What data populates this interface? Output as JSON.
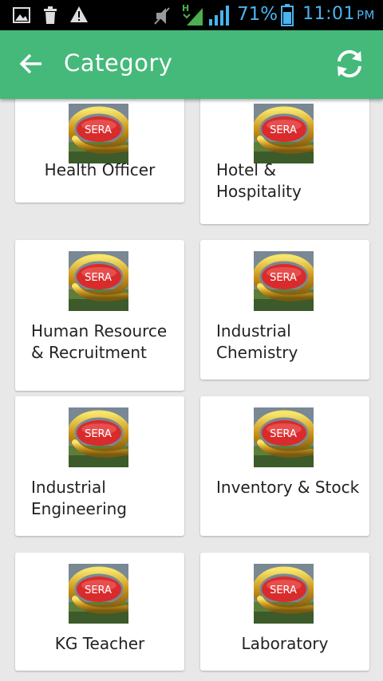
{
  "status_bar": {
    "battery_percent": "71%",
    "time": "11:01",
    "ampm": "PM",
    "icons": [
      "image-icon",
      "trash-icon",
      "warning-icon",
      "mute-icon",
      "signal-h-icon",
      "signal-icon",
      "battery-icon"
    ]
  },
  "app_bar": {
    "title": "Category",
    "back_icon": "arrow-left-icon",
    "refresh_icon": "refresh-icon",
    "color": "#45b97a"
  },
  "thumbnail_text": "SERA",
  "categories": [
    {
      "label": "Health Officer"
    },
    {
      "label": "Hotel & Hospitality"
    },
    {
      "label": "Human Resource & Recruitment"
    },
    {
      "label": "Industrial Chemistry"
    },
    {
      "label": "Industrial Engineering"
    },
    {
      "label": "Inventory & Stock"
    },
    {
      "label": "KG Teacher"
    },
    {
      "label": "Laboratory"
    }
  ]
}
